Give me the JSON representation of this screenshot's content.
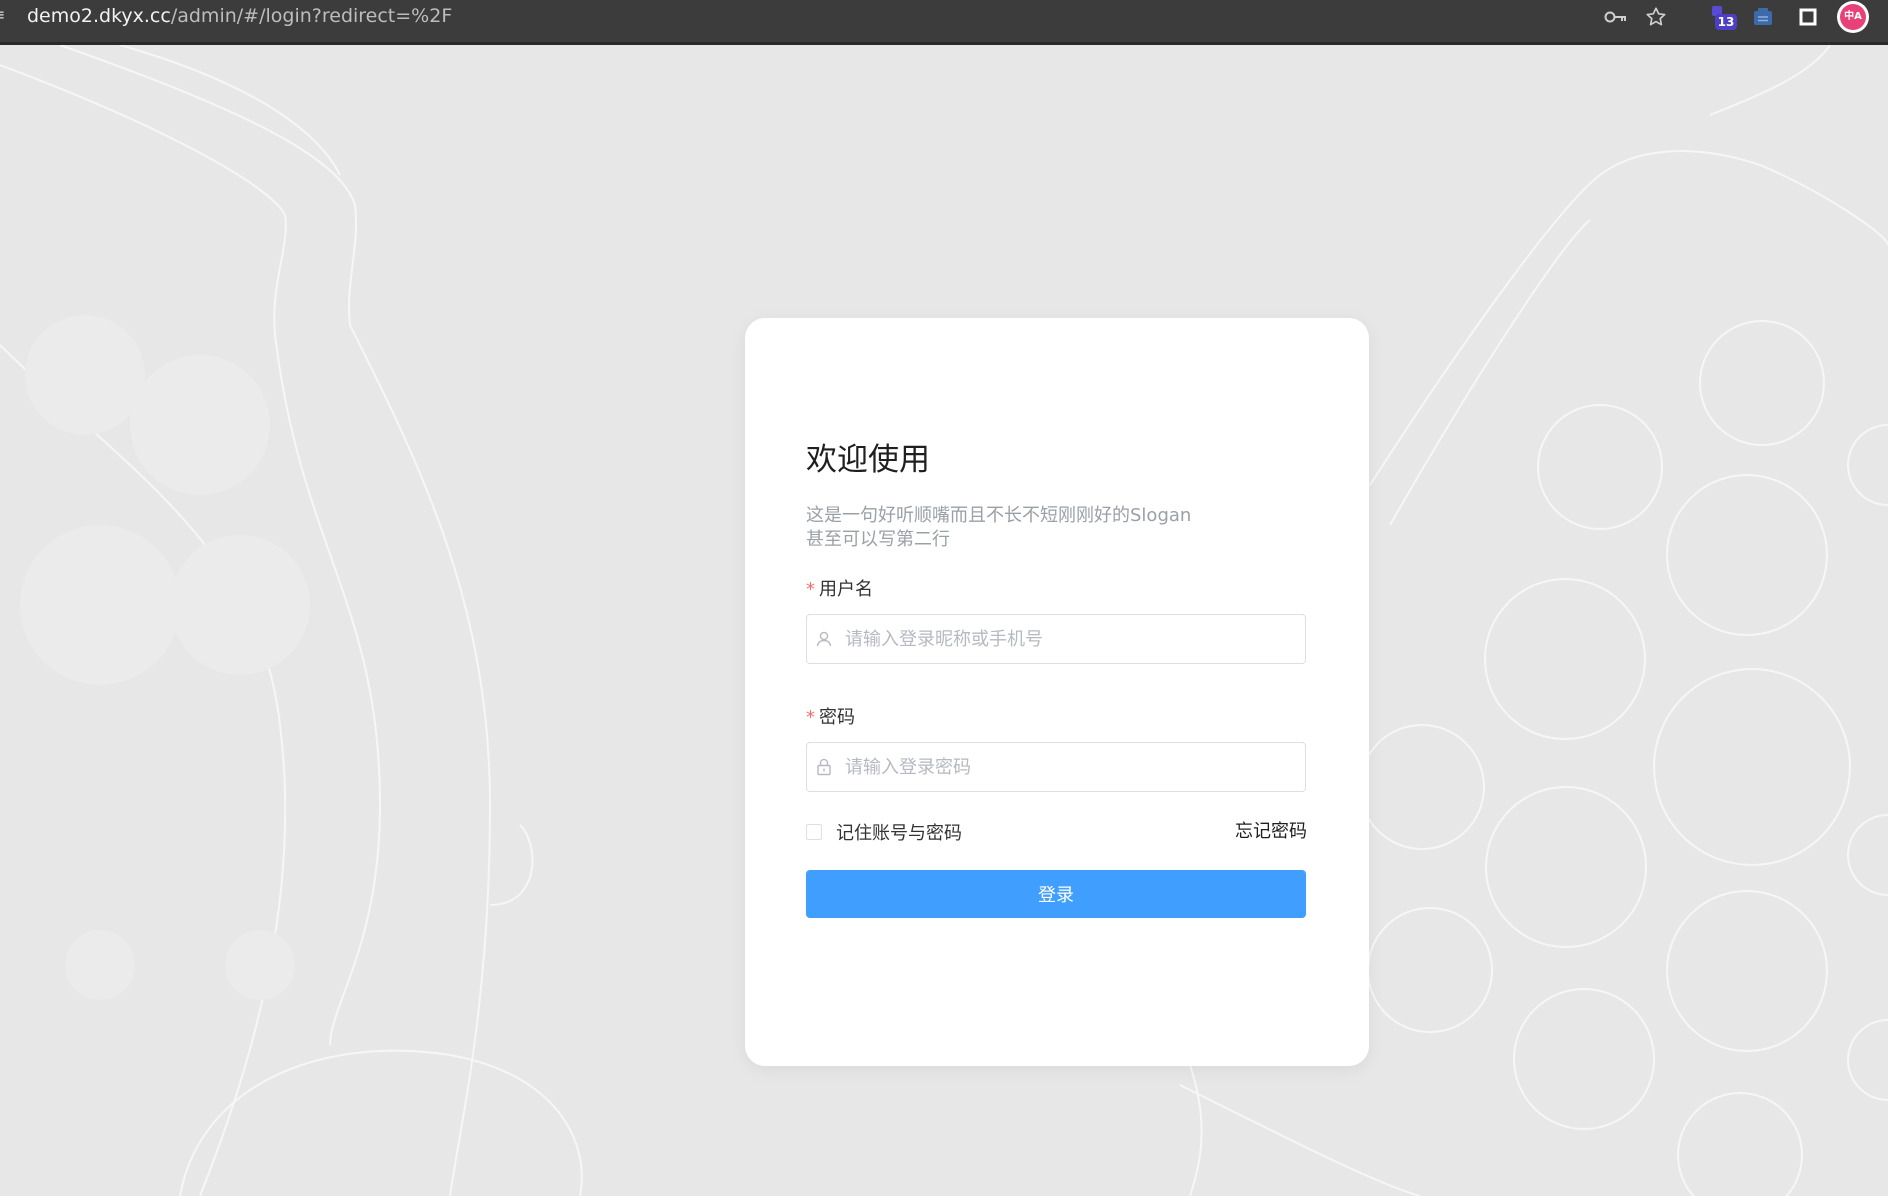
{
  "browser": {
    "url_host": "demo2.dkyx.cc",
    "url_path": "/admin/#/login?redirect=%2F",
    "extension_badge_count": "13",
    "profile_initials": "中A"
  },
  "login": {
    "title": "欢迎使用",
    "slogan_line1": "这是一句好听顺嘴而且不长不短刚刚好的Slogan",
    "slogan_line2": "甚至可以写第二行",
    "required_mark": "*",
    "username_label": "用户名",
    "username_placeholder": "请输入登录昵称或手机号",
    "username_value": "",
    "password_label": "密码",
    "password_placeholder": "请输入登录密码",
    "password_value": "",
    "remember_label": "记住账号与密码",
    "remember_checked": false,
    "forgot_label": "忘记密码",
    "login_button": "登录"
  },
  "colors": {
    "primary": "#409eff",
    "required": "#f56c6c",
    "page_background": "#e7e7e7"
  },
  "icons": {
    "username": "user-icon",
    "password": "lock-icon",
    "toolbar": [
      "key-icon",
      "star-icon",
      "extension-icon",
      "square-icon",
      "profile-avatar"
    ]
  }
}
